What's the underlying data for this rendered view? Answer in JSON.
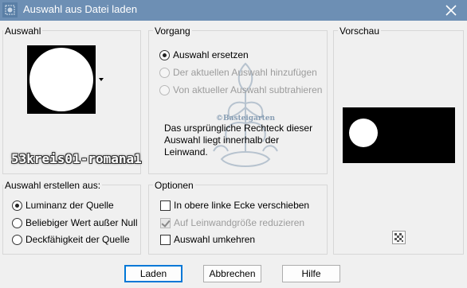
{
  "window": {
    "title": "Auswahl aus Datei laden"
  },
  "selection_panel": {
    "label": "Auswahl",
    "watermark": "53kreis01-romana1"
  },
  "operation_panel": {
    "label": "Vorgang",
    "options": [
      {
        "label": "Auswahl ersetzen",
        "checked": true,
        "enabled": true
      },
      {
        "label": "Der aktuellen Auswahl hinzufügen",
        "checked": false,
        "enabled": false
      },
      {
        "label": "Von aktueller Auswahl subtrahieren",
        "checked": false,
        "enabled": false
      }
    ],
    "info": "Das ursprüngliche Rechteck dieser Auswahl liegt innerhalb der Leinwand.",
    "watermark_logo_text": "©Basteigarten"
  },
  "preview_panel": {
    "label": "Vorschau"
  },
  "create_panel": {
    "label": "Auswahl erstellen aus:",
    "options": [
      {
        "label": "Luminanz der Quelle",
        "checked": true
      },
      {
        "label": "Beliebiger Wert außer Null",
        "checked": false
      },
      {
        "label": "Deckfähigkeit der Quelle",
        "checked": false
      }
    ]
  },
  "options_panel": {
    "label": "Optionen",
    "options": [
      {
        "label": "In obere linke Ecke verschieben",
        "checked": false,
        "enabled": true
      },
      {
        "label": "Auf Leinwandgröße reduzieren",
        "checked": true,
        "enabled": false
      },
      {
        "label": "Auswahl umkehren",
        "checked": false,
        "enabled": true
      }
    ]
  },
  "buttons": {
    "load": "Laden",
    "cancel": "Abbrechen",
    "help": "Hilfe"
  },
  "icons": {
    "app": "selection-icon",
    "close": "close-icon",
    "dropdown": "chevron-down-icon",
    "transparency": "checkerboard-icon"
  }
}
